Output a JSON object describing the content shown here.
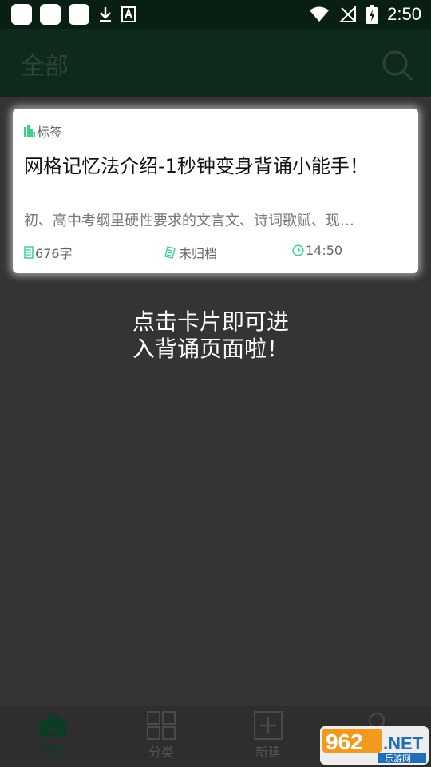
{
  "status_bar": {
    "time": "2:50"
  },
  "app_bar": {
    "title": "全部"
  },
  "card": {
    "tag_label": "标签",
    "title": "网格记忆法介绍-1秒钟变身背诵小能手！",
    "snippet": "初、高中考纲里硬性要求的文言文、诗词歌赋、现…",
    "word_count": "676字",
    "archive_status": "未归档",
    "time": "14:50"
  },
  "hint": {
    "line1": "点击卡片即可进",
    "line2": "入背诵页面啦！"
  },
  "bottom_nav": {
    "items": [
      {
        "label": "首页",
        "icon": "home-icon",
        "active": true
      },
      {
        "label": "分类",
        "icon": "grid-icon",
        "active": false
      },
      {
        "label": "新建",
        "icon": "add-icon",
        "active": false
      },
      {
        "label": "",
        "icon": "user-icon",
        "active": false
      }
    ]
  },
  "watermark": {
    "brand": "962.NET",
    "sub": "乐游网"
  },
  "colors": {
    "accent": "#3ecf8e",
    "app_bar": "#0f2a1b",
    "background": "#343434"
  }
}
